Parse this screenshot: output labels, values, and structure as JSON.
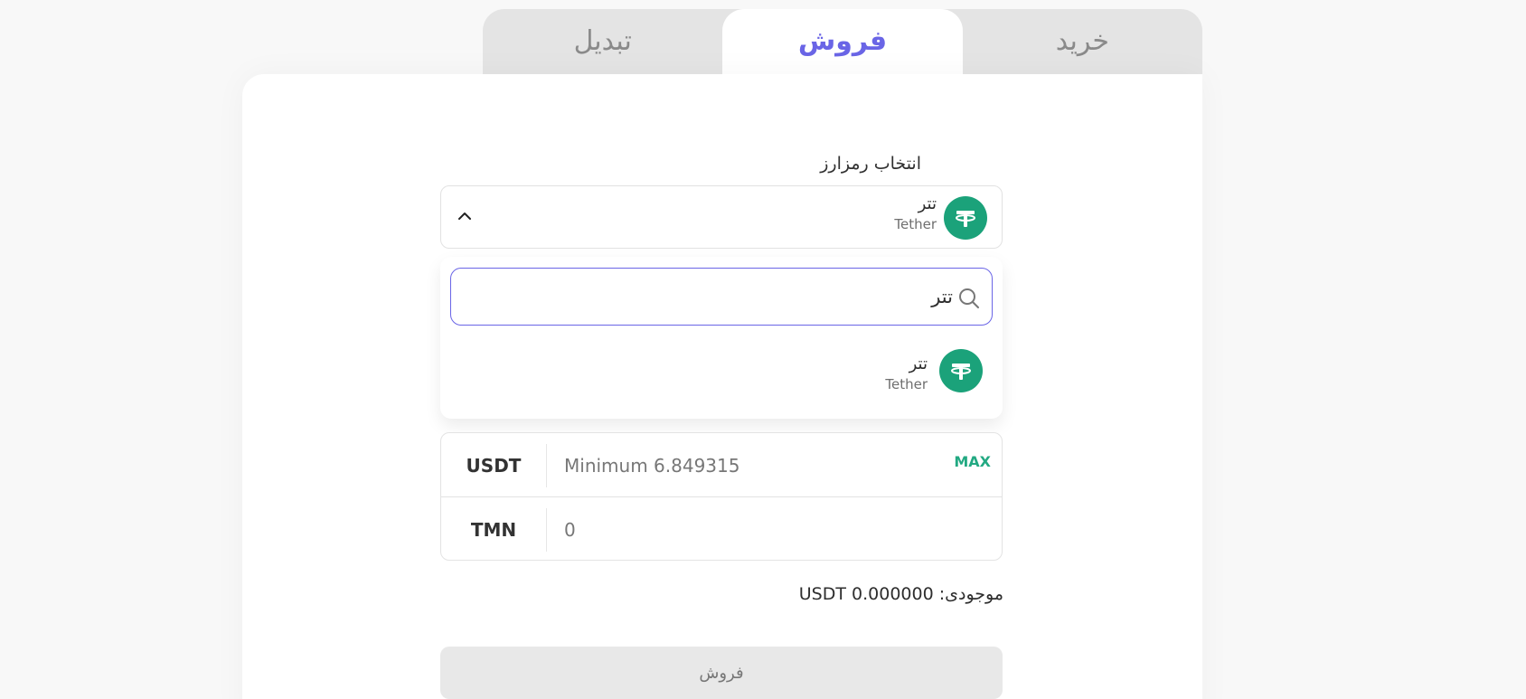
{
  "tabs": [
    {
      "label": "خرید"
    },
    {
      "label": "فروش"
    },
    {
      "label": "تبدیل"
    }
  ],
  "crypto_label": "انتخاب رمزارز",
  "selected": {
    "name": "تتر",
    "code": "Tether"
  },
  "search": {
    "value": "تتر"
  },
  "result": {
    "name": "تتر",
    "code": "Tether"
  },
  "amount_rows": [
    {
      "currency": "USDT",
      "placeholder": "Minimum 6.849315",
      "value": ""
    },
    {
      "currency": "TMN",
      "placeholder": "0",
      "value": ""
    }
  ],
  "max_label": "MAX",
  "balance_text": "موجودی: USDT 0.000000",
  "submit_label": "فروش",
  "colors": {
    "accent": "#6a65e6",
    "tether": "#1ba27a",
    "max": "#22a982"
  }
}
